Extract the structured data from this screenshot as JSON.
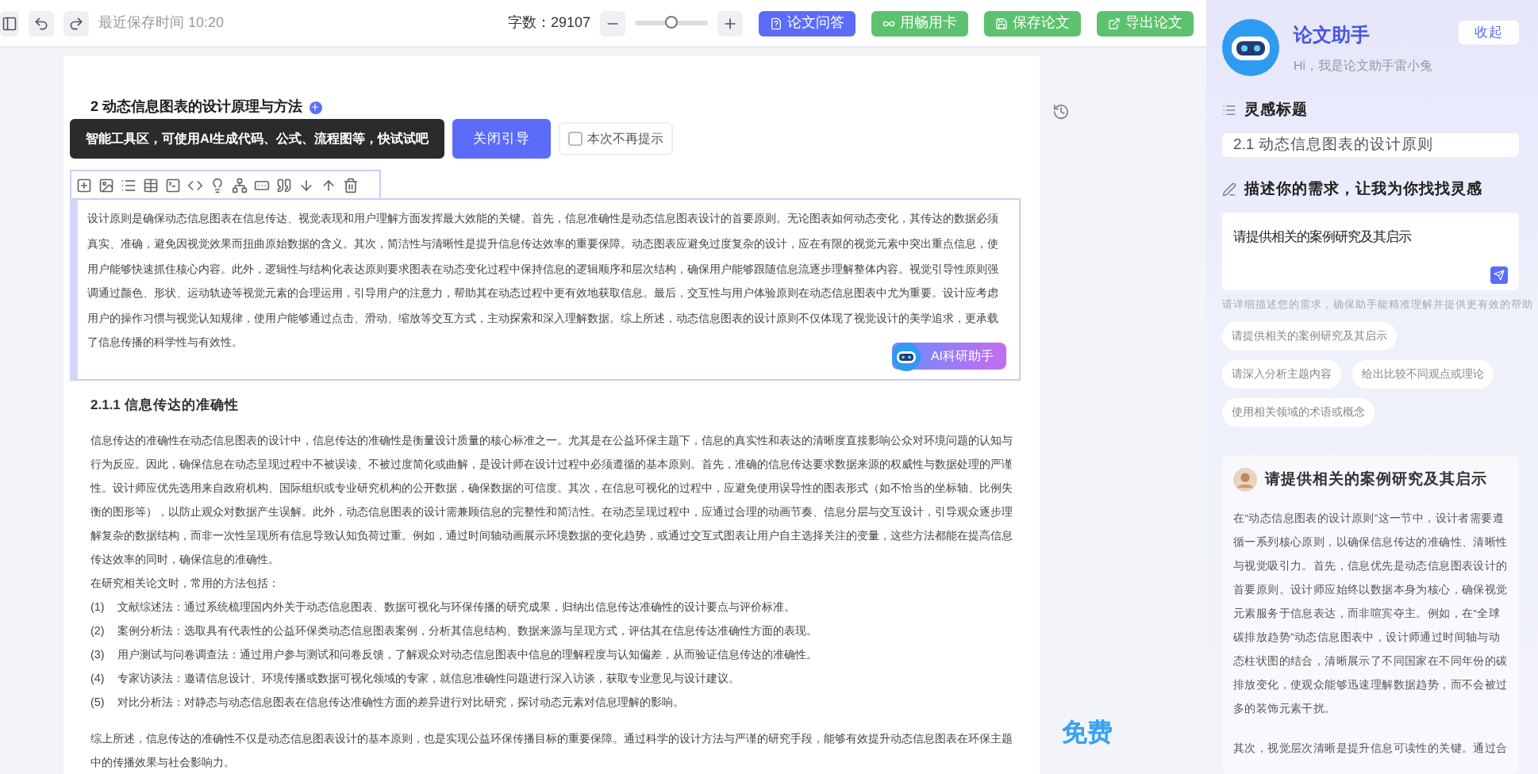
{
  "toolbar": {
    "save_time": "最近保存时间 10:20",
    "word_count": "字数：29107",
    "zoom": {
      "level": 0.5
    },
    "buttons": [
      {
        "label": "论文问答",
        "kind": "primary"
      },
      {
        "label": "用畅用卡",
        "kind": "success"
      },
      {
        "label": "保存论文",
        "kind": "success"
      },
      {
        "label": "导出论文",
        "kind": "success"
      }
    ]
  },
  "document": {
    "heading": "2 动态信息图表的设计原理与方法",
    "guide": {
      "text": "智能工具区，可使用AI生成代码、公式、流程图等，快试试吧",
      "close_label": "关闭引导",
      "checkbox": {
        "label": "本次不再提示",
        "checked": false
      }
    },
    "block_text": "设计原则是确保动态信息图表在信息传达、视觉表现和用户理解方面发挥最大效能的关键。首先，信息准确性是动态信息图表设计的首要原则。无论图表如何动态变化，其传达的数据必须真实、准确，避免因视觉效果而扭曲原始数据的含义。其次，简洁性与清晰性是提升信息传达效率的重要保障。动态图表应避免过度复杂的设计，应在有限的视觉元素中突出重点信息，使用户能够快速抓住核心内容。此外，逻辑性与结构化表达原则要求图表在动态变化过程中保持信息的逻辑顺序和层次结构，确保用户能够跟随信息流逐步理解整体内容。视觉引导性原则强调通过颜色、形状、运动轨迹等视觉元素的合理运用，引导用户的注意力，帮助其在动态过程中更有效地获取信息。最后，交互性与用户体验原则在动态信息图表中尤为重要。设计应考虑用户的操作习惯与视觉认知规律，使用户能够通过点击、滑动、缩放等交互方式，主动探索和深入理解数据。综上所述，动态信息图表的设计原则不仅体现了视觉设计的美学追求，更承载了信息传播的科学性与有效性。",
    "ai_button": "AI科研助手",
    "section_heading": "2.1.1 信息传达的准确性",
    "paragraph": "信息传达的准确性在动态信息图表的设计中，信息传达的准确性是衡量设计质量的核心标准之一。尤其是在公益环保主题下，信息的真实性和表达的清晰度直接影响公众对环境问题的认知与行为反应。因此，确保信息在动态呈现过程中不被误读、不被过度简化或曲解，是设计师在设计过程中必须遵循的基本原则。首先，准确的信息传达要求数据来源的权威性与数据处理的严谨性。设计师应优先选用来自政府机构、国际组织或专业研究机构的公开数据，确保数据的可信度。其次，在信息可视化的过程中，应避免使用误导性的图表形式（如不恰当的坐标轴、比例失衡的图形等），以防止观众对数据产生误解。此外，动态信息图表的设计需兼顾信息的完整性和简洁性。在动态呈现过程中，应通过合理的动画节奏、信息分层与交互设计，引导观众逐步理解复杂的数据结构，而非一次性呈现所有信息导致认知负荷过重。例如，通过时间轴动画展示环境数据的变化趋势，或通过交互式图表让用户自主选择关注的变量，这些方法都能在提高信息传达效率的同时，确保信息的准确性。",
    "intro": "在研究相关论文时，常用的方法包括：",
    "methods": [
      {
        "num": "(1)",
        "text": "文献综述法：通过系统梳理国内外关于动态信息图表、数据可视化与环保传播的研究成果，归纳出信息传达准确性的设计要点与评价标准。"
      },
      {
        "num": "(2)",
        "text": "案例分析法：选取具有代表性的公益环保类动态信息图表案例，分析其信息结构、数据来源与呈现方式，评估其在信息传达准确性方面的表现。"
      },
      {
        "num": "(3)",
        "text": "用户测试与问卷调查法：通过用户参与测试和问卷反馈，了解观众对动态信息图表中信息的理解程度与认知偏差，从而验证信息传达的准确性。"
      },
      {
        "num": "(4)",
        "text": "专家访谈法：邀请信息设计、环境传播或数据可视化领域的专家，就信息准确性问题进行深入访谈，获取专业意见与设计建议。"
      },
      {
        "num": "(5)",
        "text": "对比分析法：对静态与动态信息图表在信息传达准确性方面的差异进行对比研究，探讨动态元素对信息理解的影响。"
      }
    ],
    "summary": "综上所述，信息传达的准确性不仅是动态信息图表设计的基本原则，也是实现公益环保传播目标的重要保障。通过科学的设计方法与严谨的研究手段，能够有效提升动态信息图表在环保主题中的传播效果与社会影响力。"
  },
  "free_badge": "免费",
  "assistant": {
    "title": "论文助手",
    "greeting": "Hi，我是论文助手雷小兔",
    "collapse": "收起",
    "inspiration_label": "灵感标题",
    "title_field": "2.1 动态信息图表的设计原则",
    "need_label": "描述你的需求，让我为你找找灵感",
    "need_field": "请提供相关的案例研究及其启示",
    "hint": "请详细描述您的需求，确保助手能精准理解并提供更有效的帮助",
    "suggestions": [
      "请提供相关的案例研究及其启示",
      "请深入分析主题内容",
      "给出比较不同观点或理论",
      "使用相关领域的术语或概念"
    ],
    "card": {
      "title": "请提供相关的案例研究及其启示",
      "paragraphs": [
        "在“动态信息图表的设计原则”这一节中，设计者需要遵循一系列核心原则，以确保信息传达的准确性、清晰性与视觉吸引力。首先，信息优先是动态信息图表设计的首要原则。设计师应始终以数据本身为核心，确保视觉元素服务于信息表达，而非喧宾夺主。例如，在“全球碳排放趋势”动态信息图表中，设计师通过时间轴与动态柱状图的结合，清晰展示了不同国家在不同年份的碳排放变化，使观众能够迅速理解数据趋势，而不会被过多的装饰元素干扰。",
        "其次，视觉层次清晰是提升信息可读性的关键。通过合"
      ]
    }
  }
}
